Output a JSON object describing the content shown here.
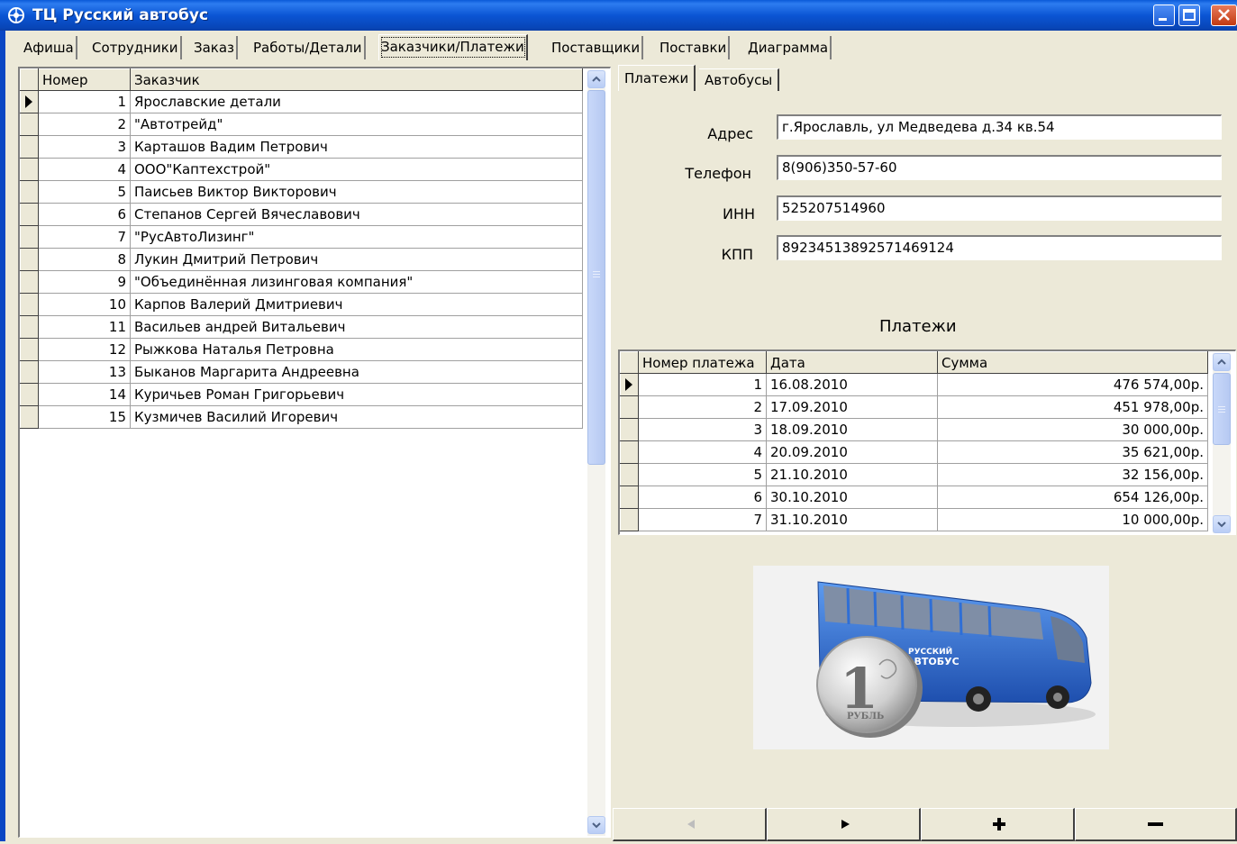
{
  "window": {
    "title": "ТЦ Русский автобус"
  },
  "main_tabs": [
    {
      "label": "Афиша"
    },
    {
      "label": "Сотрудники"
    },
    {
      "label": "Заказ"
    },
    {
      "label": "Работы/Детали"
    },
    {
      "label": "Заказчики/Платежи"
    },
    {
      "label": "Поставщики"
    },
    {
      "label": "Поставки"
    },
    {
      "label": "Диаграмма"
    }
  ],
  "customers": {
    "columns": [
      "Номер",
      "Заказчик"
    ],
    "rows": [
      {
        "num": "1",
        "name": "Ярославские детали"
      },
      {
        "num": "2",
        "name": "\"Автотрейд\""
      },
      {
        "num": "3",
        "name": "Карташов Вадим Петрович"
      },
      {
        "num": "4",
        "name": "ООО\"Каптехстрой\""
      },
      {
        "num": "5",
        "name": "Паисьев Виктор Викторович"
      },
      {
        "num": "6",
        "name": "Степанов Сергей Вячеславович"
      },
      {
        "num": "7",
        "name": "\"РусАвтоЛизинг\""
      },
      {
        "num": "8",
        "name": "Лукин Дмитрий Петрович"
      },
      {
        "num": "9",
        "name": "\"Объединённая лизинговая компания\""
      },
      {
        "num": "10",
        "name": "Карпов Валерий Дмитриевич"
      },
      {
        "num": "11",
        "name": "Васильев андрей Витальевич"
      },
      {
        "num": "12",
        "name": "Рыжкова Наталья Петровна"
      },
      {
        "num": "13",
        "name": "Быканов Маргарита Андреевна"
      },
      {
        "num": "14",
        "name": "Куричьев Роман Григорьевич"
      },
      {
        "num": "15",
        "name": "Кузмичев Василий Игоревич"
      }
    ]
  },
  "sub_tabs": [
    {
      "label": "Платежи"
    },
    {
      "label": "Автобусы"
    }
  ],
  "details": {
    "address_label": "Адрес",
    "address_value": "г.Ярославль, ул Медведева д.34 кв.54",
    "phone_label": "Телефон",
    "phone_value": "8(906)350-57-60",
    "inn_label": "ИНН",
    "inn_value": "525207514960",
    "kpp_label": "КПП",
    "kpp_value": "89234513892571469124"
  },
  "payments": {
    "title": "Платежи",
    "columns": [
      "Номер платежа",
      "Дата",
      "Сумма"
    ],
    "rows": [
      {
        "num": "1",
        "date": "16.08.2010",
        "sum": "476 574,00р."
      },
      {
        "num": "2",
        "date": "17.09.2010",
        "sum": "451 978,00р."
      },
      {
        "num": "3",
        "date": "18.09.2010",
        "sum": "30 000,00р."
      },
      {
        "num": "4",
        "date": "20.09.2010",
        "sum": "35 621,00р."
      },
      {
        "num": "5",
        "date": "21.10.2010",
        "sum": "32 156,00р."
      },
      {
        "num": "6",
        "date": "30.10.2010",
        "sum": "654 126,00р."
      },
      {
        "num": "7",
        "date": "31.10.2010",
        "sum": "10 000,00р."
      }
    ]
  },
  "picture": {
    "bus_logo_line1": "РУССКИЙ",
    "bus_logo_line2": "АВТОБУС",
    "coin_value": "1",
    "coin_text": "РУБЛЬ"
  },
  "navigator": {
    "prior_icon": "prior-icon",
    "next_icon": "next-icon",
    "insert_icon": "plus-icon",
    "delete_icon": "minus-icon"
  },
  "colors": {
    "titlebar": "#0b55d4",
    "bus_body": "#2f6fd6",
    "window_bg": "#ece9d8"
  }
}
